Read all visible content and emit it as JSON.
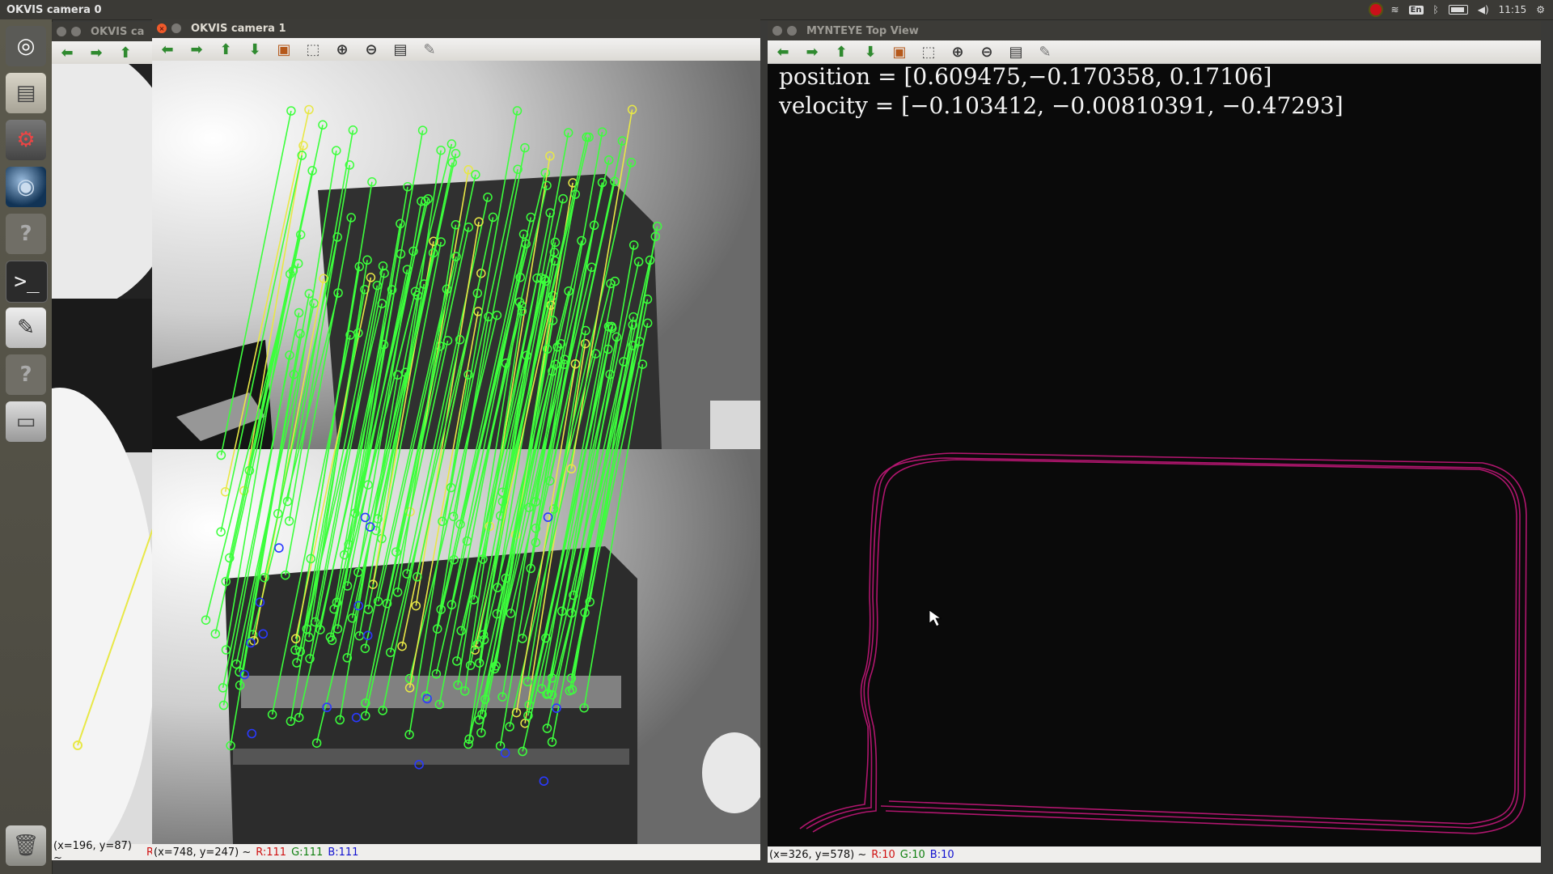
{
  "topbar": {
    "title": "OKVIS camera 0",
    "clock": "11:15",
    "lang": "En"
  },
  "launcher": {
    "items": [
      {
        "name": "ubuntu-dash",
        "glyph": "◎"
      },
      {
        "name": "files",
        "glyph": "▤"
      },
      {
        "name": "system-settings",
        "glyph": "⚙"
      },
      {
        "name": "browser",
        "glyph": "◉"
      },
      {
        "name": "unknown-app",
        "glyph": "?"
      },
      {
        "name": "terminal",
        "glyph": ">_"
      },
      {
        "name": "text-editor",
        "glyph": "✎"
      },
      {
        "name": "unknown-app-2",
        "glyph": "?"
      },
      {
        "name": "drive",
        "glyph": "▭"
      },
      {
        "name": "trash",
        "glyph": "🗑"
      }
    ]
  },
  "cam0": {
    "title": "OKVIS ca",
    "status_pos": "(x=196, y=87) ~",
    "status_r": "R:"
  },
  "cam1": {
    "title": "OKVIS camera 1",
    "status_pos": "(x=748, y=247) ~",
    "status_r": "R:111",
    "status_g": "G:111",
    "status_b": "B:111"
  },
  "topview": {
    "title": "MYNTEYE Top View",
    "position": "position = [0.609475,−0.170358, 0.17106]",
    "velocity": "velocity = [−0.103412, −0.00810391, −0.47293]",
    "status_pos": "(x=326, y=578) ~",
    "status_r": "R:10",
    "status_g": "G:10",
    "status_b": "B:10"
  },
  "colors": {
    "track": "#b0166e",
    "feature_line": "#3cff3c",
    "feature_yellow": "#e8e846",
    "feature_blue": "#2a3aff"
  }
}
